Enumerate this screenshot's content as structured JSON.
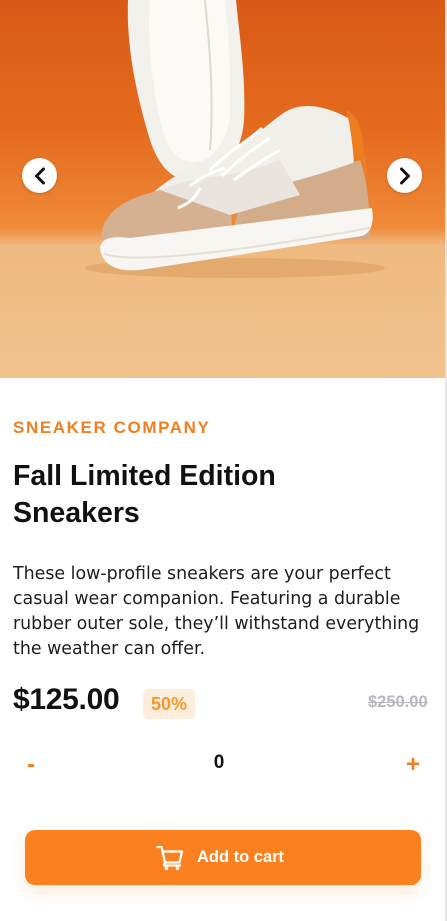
{
  "gallery": {
    "image_alt": "sneaker-photo",
    "prev_icon": "chevron-left-icon",
    "next_icon": "chevron-right-icon"
  },
  "product": {
    "brand": "SNEAKER COMPANY",
    "title": "Fall Limited Edition Sneakers",
    "description": "These low-profile sneakers are your perfect casual wear companion. Featuring a durable rubber outer sole, they’ll withstand everything the weather can offer.",
    "price": "$125.00",
    "discount": "50%",
    "original_price": "$250.00"
  },
  "quantity": {
    "minus_label": "-",
    "value": "0",
    "plus_label": "+"
  },
  "cart": {
    "button_label": "Add to cart",
    "icon": "cart-icon"
  },
  "colors": {
    "accent": "#fb8120",
    "accent_light": "#fdeddc",
    "text_dark": "#111111",
    "muted": "#b6b8bf"
  }
}
